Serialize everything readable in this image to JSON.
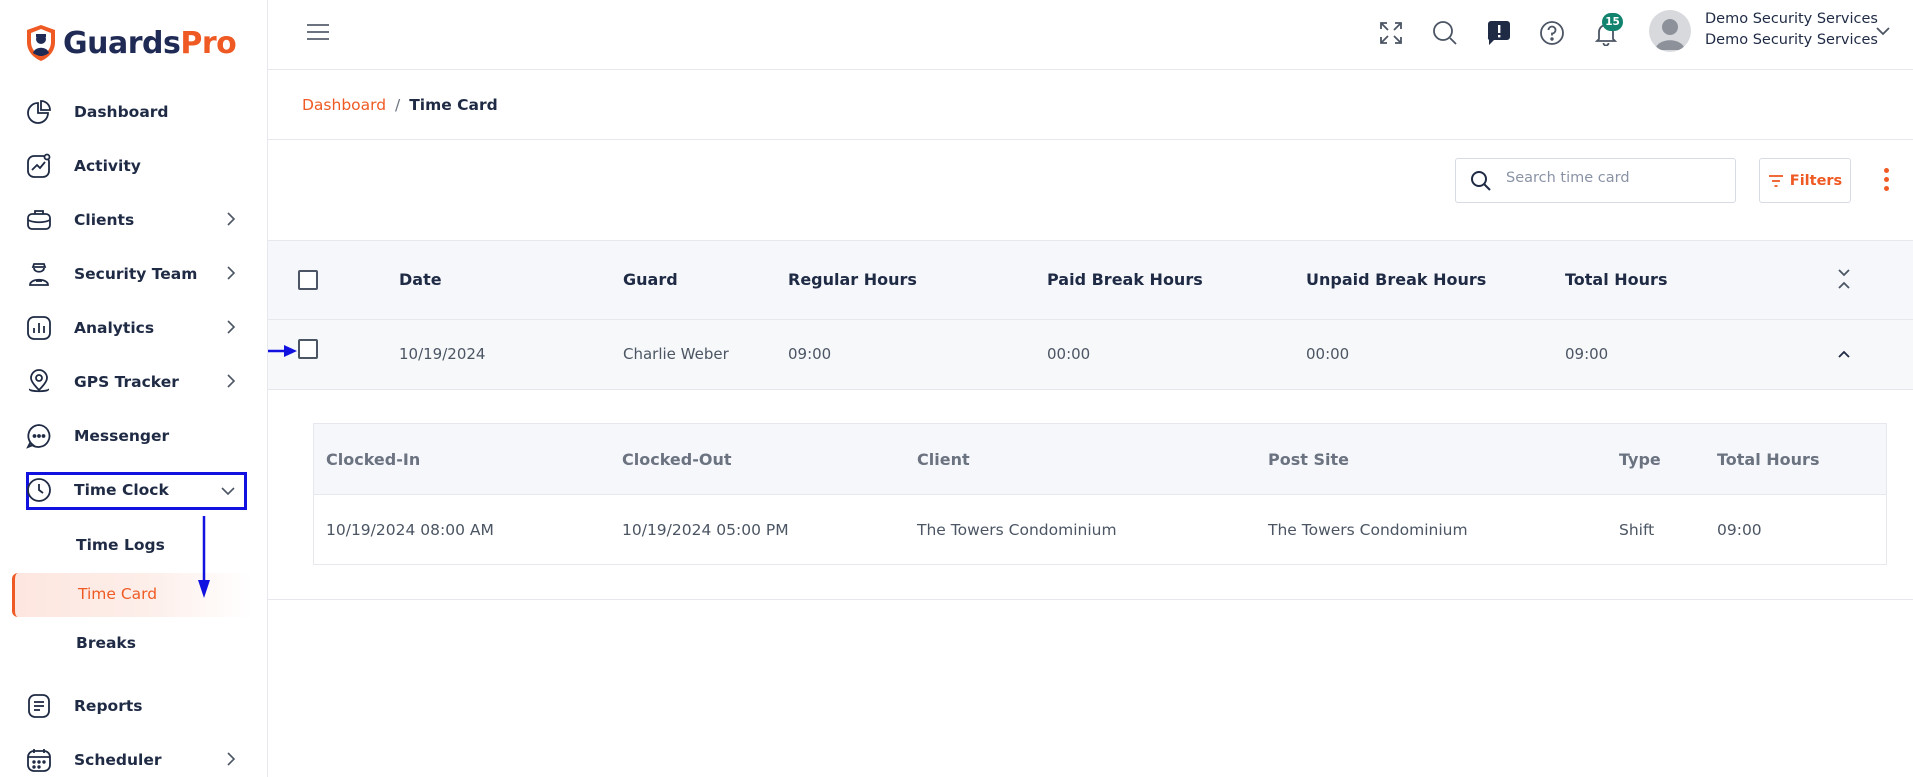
{
  "app": {
    "logo_part1": "Guards",
    "logo_part2": "Pro"
  },
  "sidebar": {
    "items": [
      {
        "label": "Dashboard",
        "icon": "pie-chart-icon"
      },
      {
        "label": "Activity",
        "icon": "activity-icon"
      },
      {
        "label": "Clients",
        "icon": "briefcase-icon"
      },
      {
        "label": "Security Team",
        "icon": "guard-icon"
      },
      {
        "label": "Analytics",
        "icon": "analytics-icon"
      },
      {
        "label": "GPS Tracker",
        "icon": "location-pin-icon"
      },
      {
        "label": "Messenger",
        "icon": "chat-bubble-icon"
      },
      {
        "label": "Time Clock",
        "icon": "clock-icon"
      },
      {
        "label": "Reports",
        "icon": "report-icon"
      },
      {
        "label": "Scheduler",
        "icon": "calendar-icon"
      }
    ],
    "time_clock_sub": {
      "time_logs": "Time Logs",
      "time_card": "Time Card",
      "breaks": "Breaks"
    }
  },
  "topbar": {
    "notification_count": "15",
    "user_name": "Demo Security Services",
    "user_org": "Demo Security Services"
  },
  "breadcrumb": {
    "root": "Dashboard",
    "separator": "/",
    "current": "Time Card"
  },
  "toolbar": {
    "search_placeholder": "Search time card",
    "filters_label": "Filters"
  },
  "table": {
    "columns": [
      "Date",
      "Guard",
      "Regular Hours",
      "Paid Break Hours",
      "Unpaid Break Hours",
      "Total Hours"
    ],
    "rows": [
      {
        "date": "10/19/2024",
        "guard": "Charlie Weber",
        "regular": "09:00",
        "paid_break": "00:00",
        "unpaid_break": "00:00",
        "total": "09:00"
      }
    ]
  },
  "detail": {
    "columns": [
      "Clocked-In",
      "Clocked-Out",
      "Client",
      "Post Site",
      "Type",
      "Total Hours"
    ],
    "rows": [
      {
        "clocked_in": "10/19/2024 08:00 AM",
        "clocked_out": "10/19/2024 05:00 PM",
        "client": "The Towers Condominium",
        "post_site": "The Towers Condominium",
        "type": "Shift",
        "total": "09:00"
      }
    ]
  },
  "colors": {
    "accent": "#ef5a24",
    "navy": "#1f2a44",
    "badge": "#12836e",
    "annotation": "#1212e0"
  }
}
